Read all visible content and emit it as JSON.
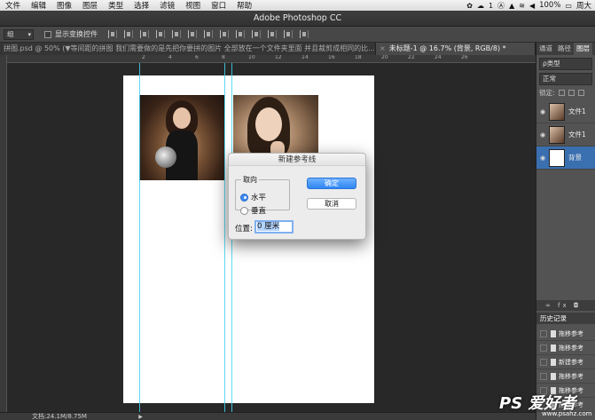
{
  "menubar": {
    "items": [
      "文件",
      "编辑",
      "图像",
      "图层",
      "类型",
      "选择",
      "滤镜",
      "视图",
      "窗口",
      "帮助"
    ],
    "status": {
      "badge": "1",
      "battery": "100%",
      "user": "周大"
    }
  },
  "app": {
    "title": "Adobe Photoshop CC"
  },
  "options": {
    "select_value": "组",
    "checkbox_label": "显示变换控件"
  },
  "tabs": [
    {
      "label": "拼图.psd @ 50% (▼等间距的拼图 我们需要做的是先把你要拼的图片 全部放在一个文件夹里面 并且裁剪成相同的比..."
    },
    {
      "close": "×",
      "label": "未标题-1 @ 16.7% (背景, RGB/8) *"
    }
  ],
  "ruler": {
    "labels": [
      "2",
      "4",
      "6",
      "8",
      "10",
      "12",
      "14",
      "16",
      "18",
      "20",
      "22",
      "24",
      "26"
    ]
  },
  "dialog": {
    "title": "新建参考线",
    "group_label": "取向",
    "options": [
      "水平",
      "垂直"
    ],
    "selected": "水平",
    "ok_label": "确定",
    "cancel_label": "取消",
    "position_label": "位置:",
    "position_value": "0 厘米"
  },
  "panel": {
    "tabs": [
      "通道",
      "路径",
      "图层"
    ],
    "filter": "ρ类型",
    "blend_mode": "正常",
    "lock_label": "锁定:",
    "layers": [
      {
        "name": "文件1"
      },
      {
        "name": "文件1"
      },
      {
        "name": "背景"
      }
    ],
    "footer": "∞ fx ◘",
    "history_title": "历史记录",
    "history": [
      "拖移参考",
      "拖移参考",
      "新建参考",
      "拖移参考",
      "拖移参考",
      "拖移参考"
    ]
  },
  "statusbar": {
    "doc": "文档:24.1M/8.75M",
    "arrow": "▶"
  },
  "watermark": {
    "logo": "PS 爱好者",
    "url": "www.psahz.com"
  }
}
